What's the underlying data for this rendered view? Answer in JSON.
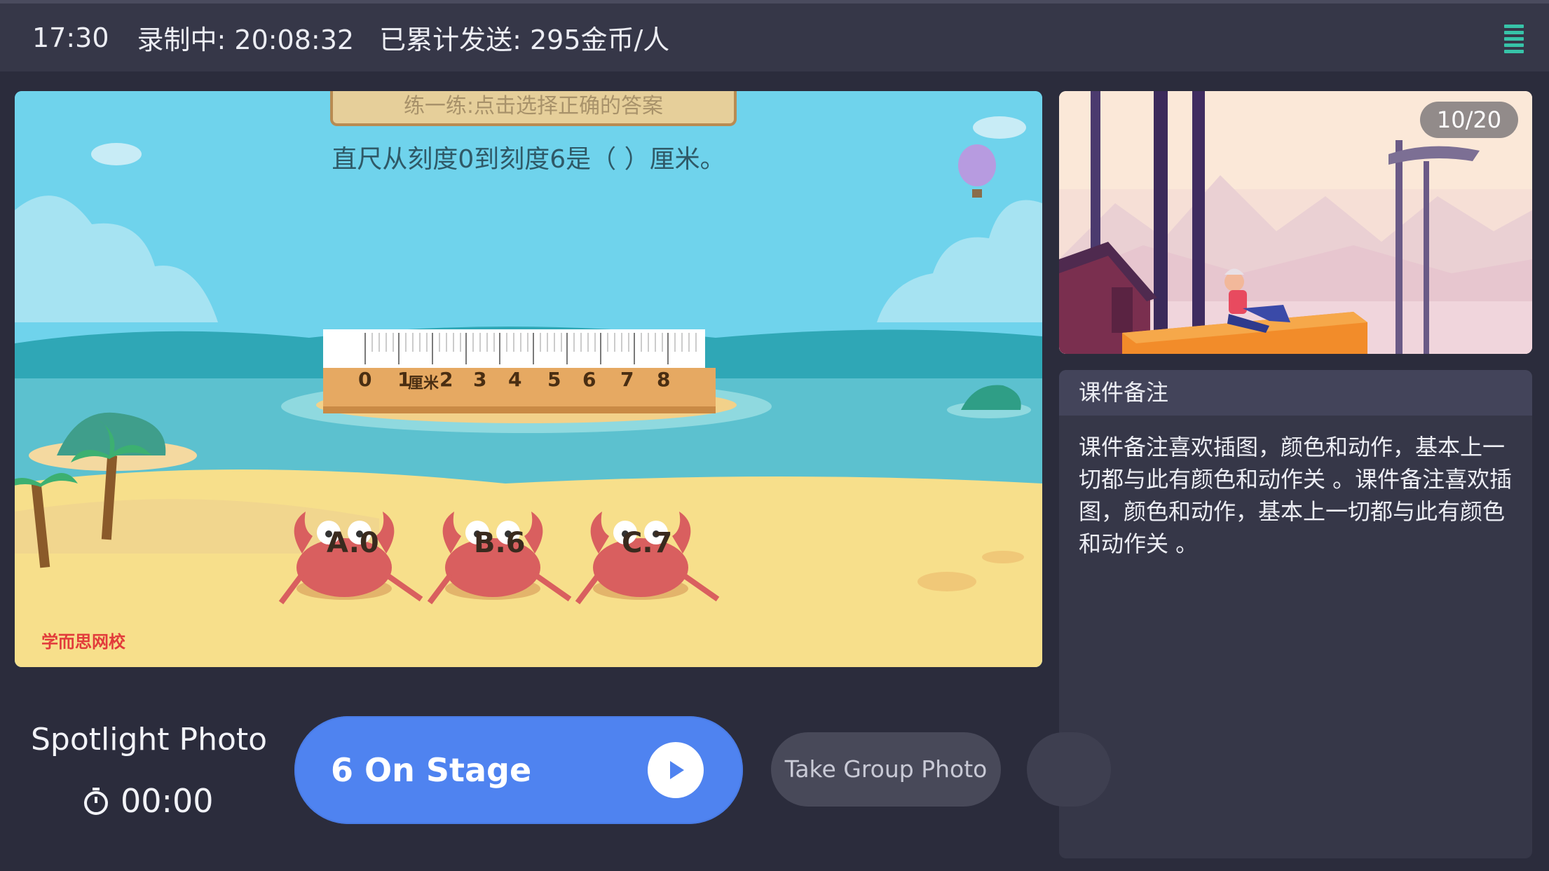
{
  "topbar": {
    "time": "17:30",
    "recording": "录制中: 20:08:32",
    "sent": "已累计发送: 295金币/人"
  },
  "courseware": {
    "banner": "练一练:点击选择正确的答案",
    "question": "直尺从刻度0到刻度6是（  ）厘米。",
    "ruler_ticks": [
      "0",
      "1",
      "2",
      "3",
      "4",
      "5",
      "6",
      "7",
      "8"
    ],
    "ruler_unit": "厘米",
    "options": [
      "A.0",
      "B.6",
      "C.7"
    ],
    "brand": "学而思网校"
  },
  "preview": {
    "page": "10/20"
  },
  "notes": {
    "title": "课件备注",
    "body": "课件备注喜欢插图，颜色和动作，基本上一切都与此有颜色和动作关 。课件备注喜欢插图，颜色和动作，基本上一切都与此有颜色和动作关 。"
  },
  "controls": {
    "spotlight_label": "Spotlight Photo",
    "timer": "00:00",
    "stage_button": "6 On Stage",
    "group_photo": "Take Group Photo"
  },
  "colors": {
    "accent": "#4f83f0",
    "signal": "#37c3a8",
    "background": "#2b2c3c"
  }
}
